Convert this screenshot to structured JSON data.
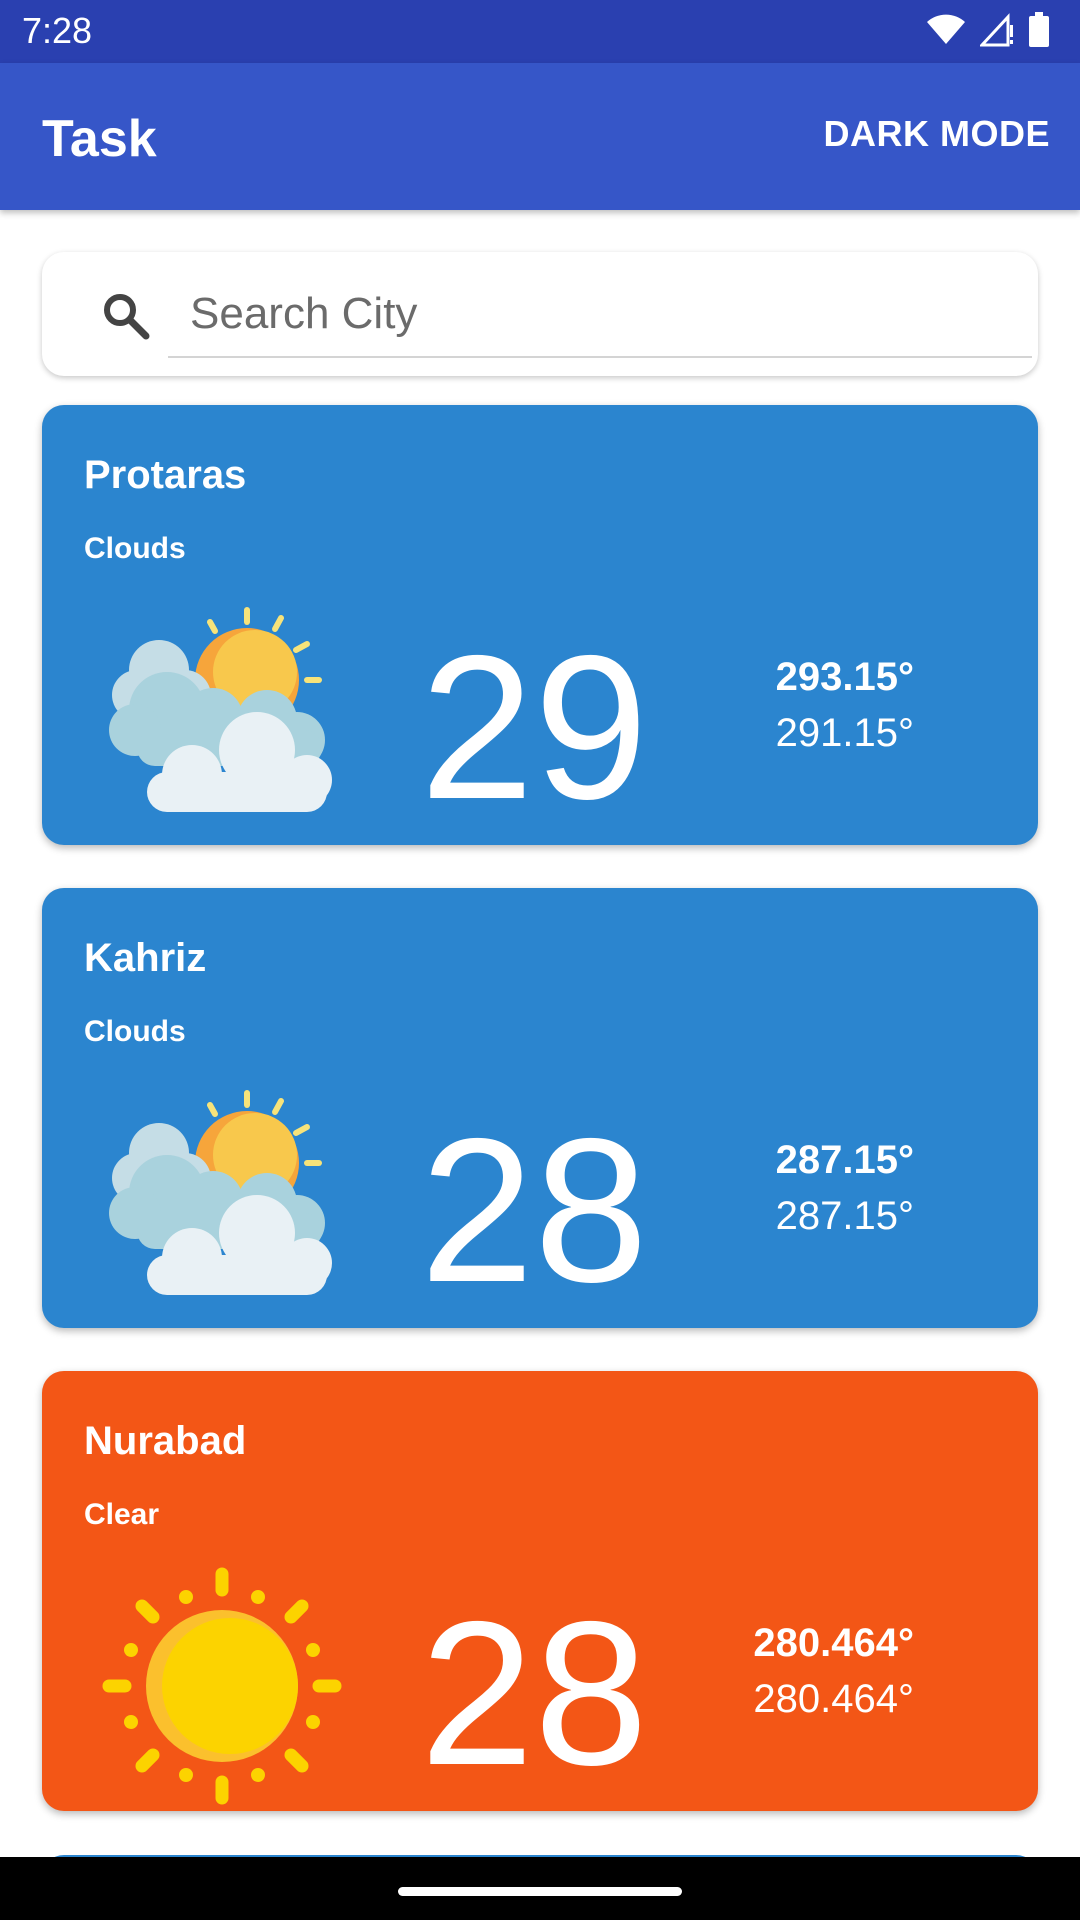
{
  "status_bar": {
    "time": "7:28",
    "icons": [
      "wifi-icon",
      "signal-icon",
      "battery-icon"
    ]
  },
  "app_bar": {
    "title": "Task",
    "dark_mode_label": "DARK MODE"
  },
  "search": {
    "placeholder": "Search City",
    "value": "",
    "icon": "search-icon"
  },
  "colors": {
    "status_bar": "#2a40b0",
    "app_bar": "#3656c8",
    "card_clouds": "#2b85cf",
    "card_clear": "#f35616"
  },
  "cards": [
    {
      "city": "Protaras",
      "condition": "Clouds",
      "icon": "cloud-sun-icon",
      "temp": "29",
      "temp_max": "293.15°",
      "temp_min": "291.15°"
    },
    {
      "city": "Kahriz",
      "condition": "Clouds",
      "icon": "cloud-sun-icon",
      "temp": "28",
      "temp_max": "287.15°",
      "temp_min": "287.15°"
    },
    {
      "city": "Nurabad",
      "condition": "Clear",
      "icon": "sun-icon",
      "temp": "28",
      "temp_max": "280.464°",
      "temp_min": "280.464°"
    }
  ]
}
